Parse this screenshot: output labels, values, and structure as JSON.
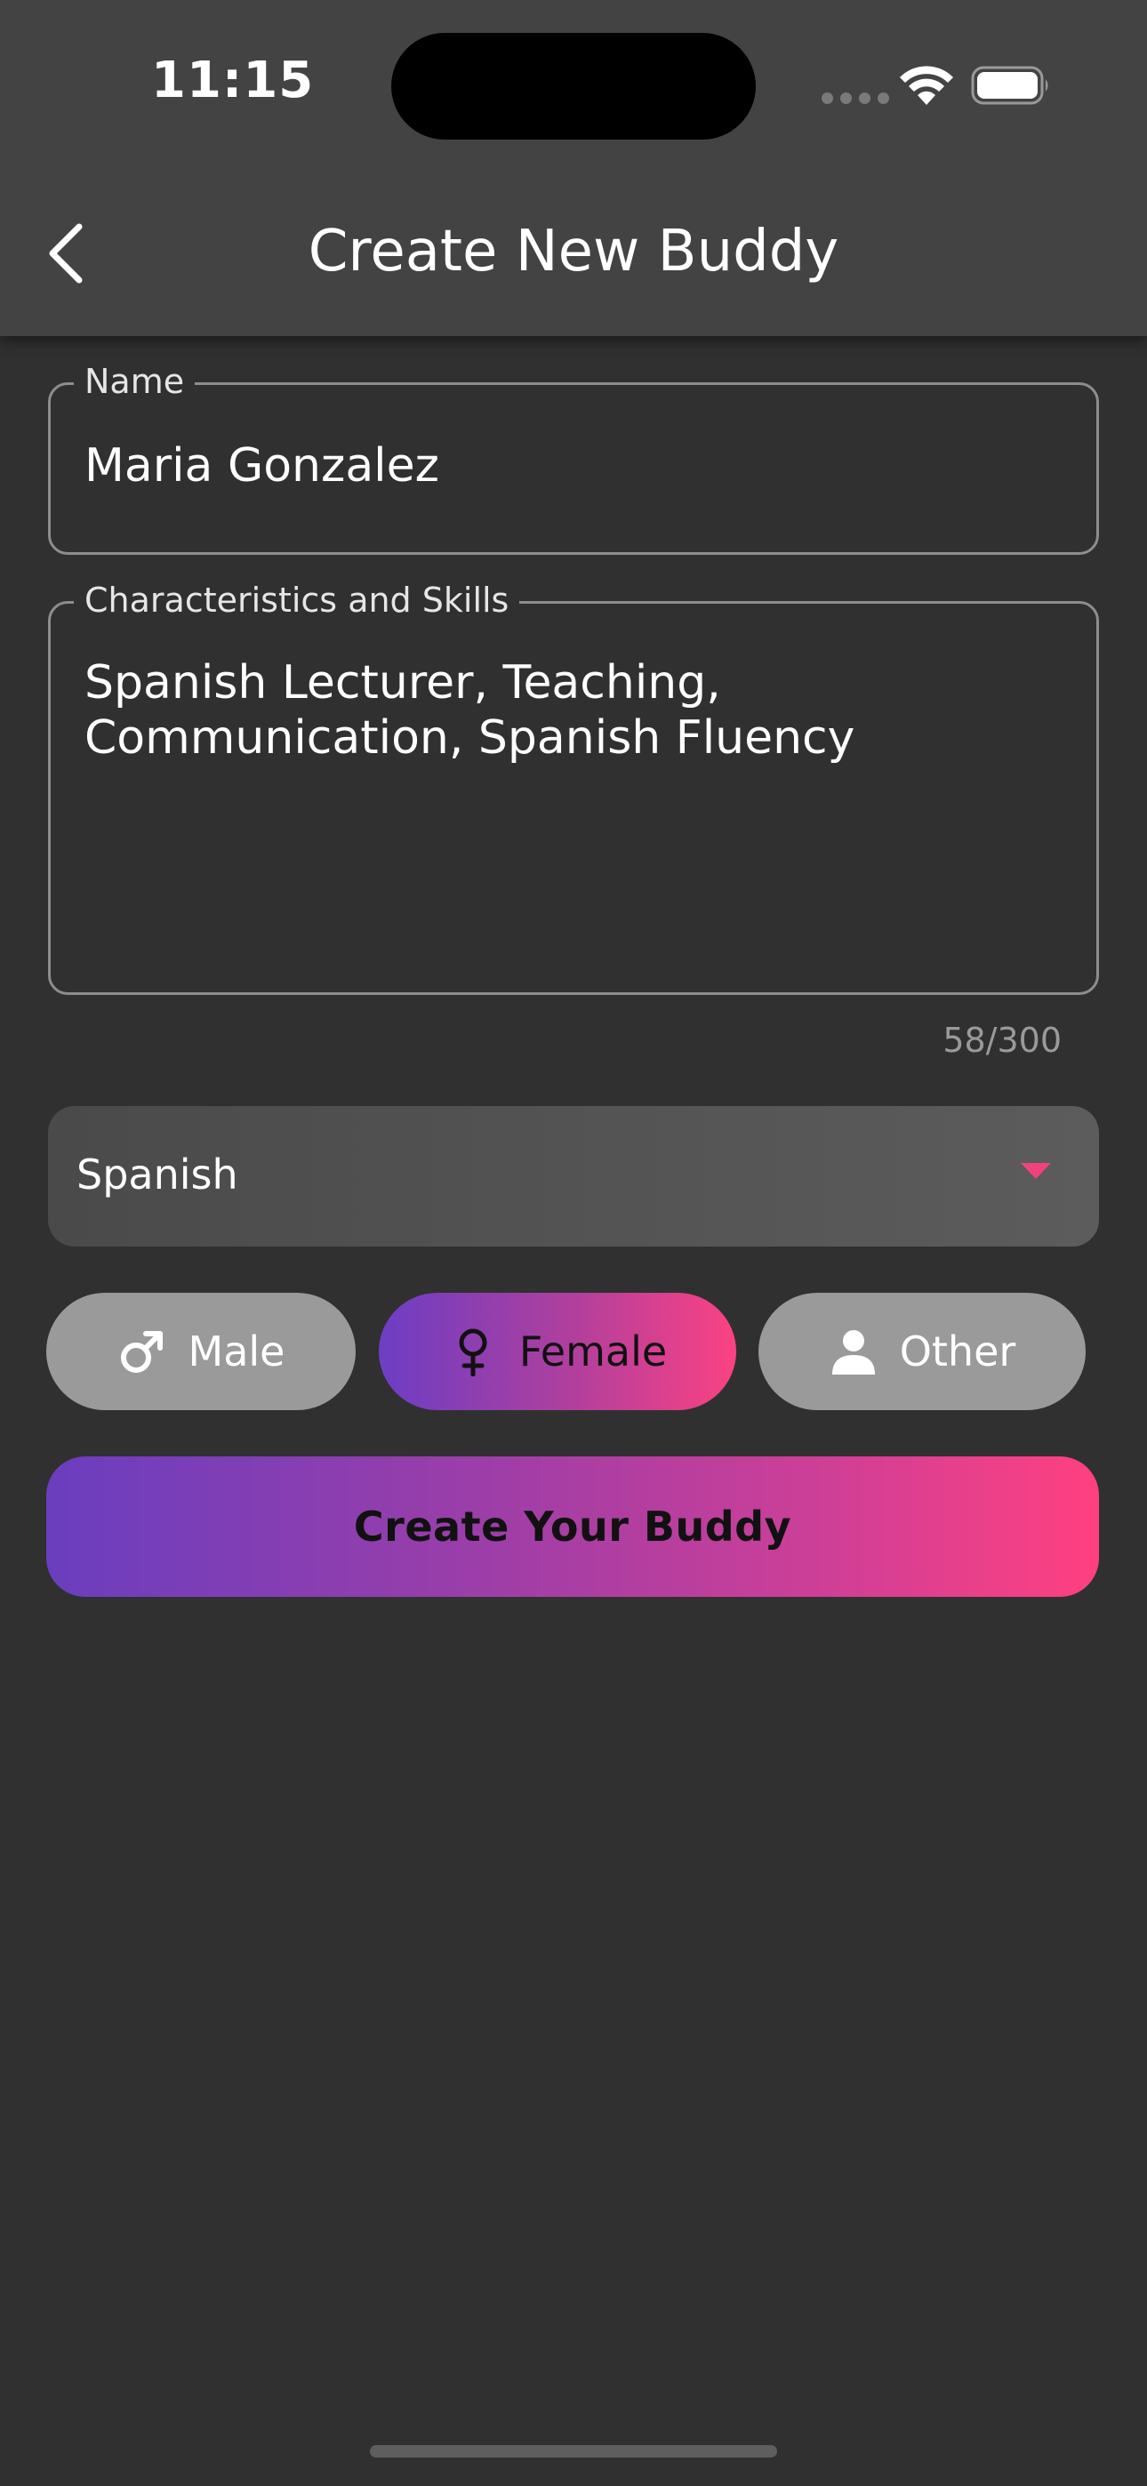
{
  "status_bar": {
    "time": "11:15"
  },
  "header": {
    "title": "Create New Buddy",
    "back_icon": "chevron-left-icon"
  },
  "form": {
    "name": {
      "label": "Name",
      "value": "Maria Gonzalez"
    },
    "skills": {
      "label": "Characteristics and Skills",
      "value": "Spanish Lecturer, Teaching,\nCommunication, Spanish Fluency",
      "counter": "58/300"
    },
    "language": {
      "selected": "Spanish",
      "arrow_color": "#f0427e"
    },
    "gender": {
      "options": [
        {
          "label": "Male",
          "icon": "male-symbol-icon",
          "selected": false
        },
        {
          "label": "Female",
          "icon": "female-symbol-icon",
          "selected": true
        },
        {
          "label": "Other",
          "icon": "person-icon",
          "selected": false
        }
      ]
    },
    "submit_label": "Create Your Buddy"
  },
  "colors": {
    "background": "#303030",
    "header": "#434343",
    "gradient_start": "#6a3ebf",
    "gradient_end": "#ff4080",
    "chip_inactive": "#9a9a9a"
  }
}
